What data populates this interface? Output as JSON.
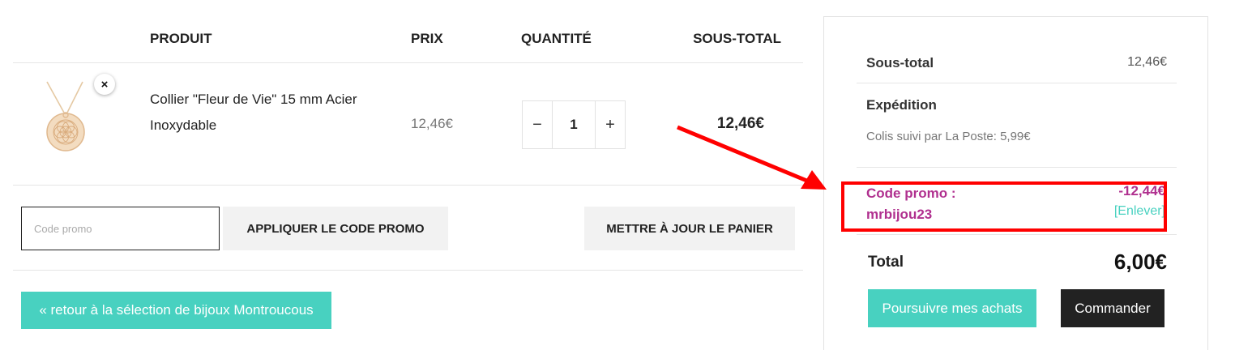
{
  "cart": {
    "headers": {
      "product": "PRODUIT",
      "price": "PRIX",
      "quantity": "QUANTITÉ",
      "subtotal": "SOUS-TOTAL"
    },
    "item": {
      "name": "Collier \"Fleur de Vie\" 15 mm Acier Inoxydable",
      "price": "12,46€",
      "quantity": "1",
      "subtotal": "12,46€",
      "remove_symbol": "×",
      "image_icon": "gold-pendant-necklace"
    },
    "qty_minus": "−",
    "qty_plus": "+"
  },
  "actions": {
    "promo_placeholder": "Code promo",
    "apply_label": "APPLIQUER LE CODE PROMO",
    "update_label": "METTRE À JOUR LE PANIER"
  },
  "back_link": "« retour à la sélection de bijoux Montroucous",
  "totals": {
    "subtotal_label": "Sous-total",
    "subtotal_value": "12,46€",
    "shipping_label": "Expédition",
    "shipping_method": "Colis suivi par La Poste: 5,99€",
    "promo_label_line1": "Code promo :",
    "promo_label_line2": "mrbijou23",
    "promo_amount": "-12,44€",
    "promo_remove": "[Enlever]",
    "total_label": "Total",
    "total_value": "6,00€",
    "continue_label": "Poursuivre mes achats",
    "checkout_label": "Commander"
  },
  "colors": {
    "accent": "#48d1c0",
    "promo": "#b0308f",
    "dark_button": "#222222",
    "annotation": "#ff0000"
  }
}
